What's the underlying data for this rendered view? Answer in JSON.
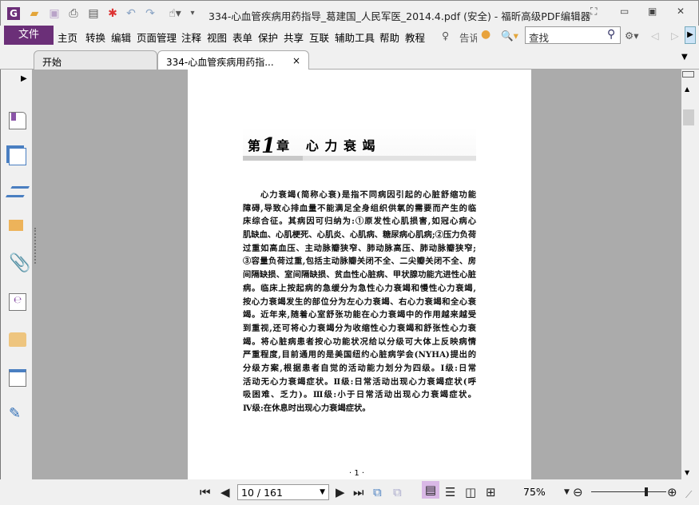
{
  "window": {
    "title": "334-心血管疾病用药指导_葛建国_人民军医_2014.4.pdf (安全) - 福昕高级PDF编辑器",
    "controls": [
      "restore-layout",
      "minimize",
      "maximize",
      "close"
    ]
  },
  "quick_access": [
    "app-logo",
    "open",
    "save",
    "print",
    "properties",
    "new",
    "undo",
    "redo",
    "hand-tool",
    "customize"
  ],
  "menu": {
    "file": "文件",
    "items": [
      "主页",
      "转换",
      "编辑",
      "页面管理",
      "注释",
      "视图",
      "表单",
      "保护",
      "共享",
      "互联",
      "辅助工具",
      "帮助",
      "教程"
    ],
    "tell_me": "告诉",
    "search_placeholder": "查找"
  },
  "tabs": [
    {
      "label": "开始",
      "active": false
    },
    {
      "label": "334-心血管疾病用药指...",
      "active": true,
      "close": "×"
    }
  ],
  "sidebar": {
    "icons": [
      "bookmark",
      "pages",
      "layers",
      "comments",
      "attachments",
      "signatures",
      "security",
      "form-fields",
      "certify"
    ]
  },
  "document": {
    "chapter": {
      "prefix": "第",
      "number": "1",
      "suffix": "章",
      "title": "心 力 衰 竭"
    },
    "lines": [
      "心力衰竭(简称心衰)是指不同病因引起的心脏舒缩功能",
      "障碍,导致心排血量不能满足全身组织供氧的需要而产生的临",
      "床综合征。其病因可归纳为:①原发性心肌损害,如冠心病心",
      "肌缺血、心肌梗死、心肌炎、心肌病、糖尿病心肌病;②压力负荷",
      "过重如高血压、主动脉瓣狭窄、肺动脉高压、肺动脉瓣狭窄;",
      "③容量负荷过重,包括主动脉瓣关闭不全、二尖瓣关闭不全、房",
      "间隔缺损、室间隔缺损、贫血性心脏病、甲状腺功能亢进性心脏",
      "病。临床上按起病的急缓分为急性心力衰竭和慢性心力衰竭,",
      "按心力衰竭发生的部位分为左心力衰竭、右心力衰竭和全心衰",
      "竭。近年来,随着心室舒张功能在心力衰竭中的作用越来越受",
      "到重视,还可将心力衰竭分为收缩性心力衰竭和舒张性心力衰",
      "竭。将心脏病患者按心功能状况给以分级可大体上反映病情",
      "严重程度,目前通用的是美国纽约心脏病学会(NYHA)提出的",
      "分级方案,根据患者自觉的活动能力划分为四级。Ⅰ级:日常",
      "活动无心力衰竭症状。Ⅱ级:日常活动出现心力衰竭症状(呼",
      "吸困难、乏力)。Ⅲ级:小于日常活动出现心力衰竭症状。",
      "Ⅳ级:在休息时出现心力衰竭症状。"
    ],
    "page_footer": "· 1 ·"
  },
  "statusbar": {
    "page": "10 / 161",
    "zoom": "75%",
    "zoom_slider_percent": 75
  },
  "colors": {
    "accent": "#6b2f78",
    "doc_bg": "#ababab"
  }
}
